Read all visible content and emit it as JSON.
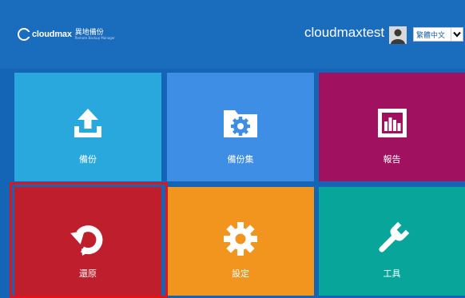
{
  "header": {
    "logo_brand": "cloudmax",
    "logo_cn": "異地備份",
    "logo_tagline": "Remote Backup Manager",
    "username": "cloudmaxtest",
    "language": "繁體中文"
  },
  "tiles": [
    {
      "label": "備份",
      "icon": "upload-icon",
      "color": "#29a8de"
    },
    {
      "label": "備份集",
      "icon": "folder-gear-icon",
      "color": "#3f8ee6"
    },
    {
      "label": "報告",
      "icon": "bar-chart-icon",
      "color": "#a0125f"
    },
    {
      "label": "還原",
      "icon": "restore-icon",
      "color": "#bf1e2d"
    },
    {
      "label": "設定",
      "icon": "gear-icon",
      "color": "#f2951f"
    },
    {
      "label": "工具",
      "icon": "wrench-icon",
      "color": "#08a59a"
    }
  ],
  "highlight": {
    "target": "還原",
    "color": "#e4131a"
  }
}
